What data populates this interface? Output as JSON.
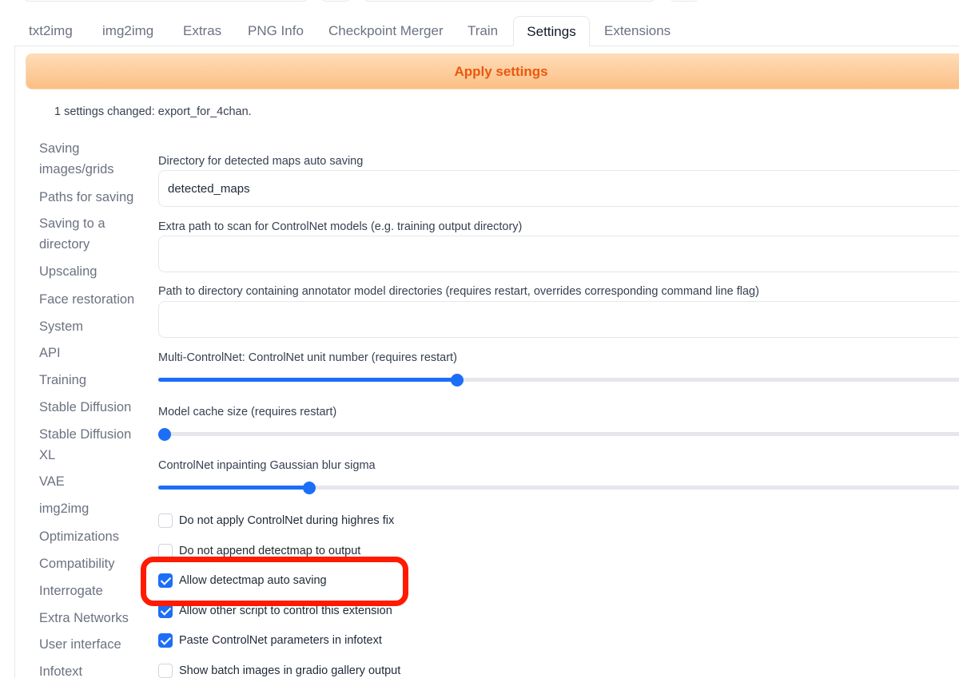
{
  "tabs": [
    {
      "label": "txt2img"
    },
    {
      "label": "img2img"
    },
    {
      "label": "Extras"
    },
    {
      "label": "PNG Info"
    },
    {
      "label": "Checkpoint Merger"
    },
    {
      "label": "Train"
    },
    {
      "label": "Settings",
      "active": true
    },
    {
      "label": "Extensions"
    }
  ],
  "apply_button": {
    "label": "Apply settings"
  },
  "changed_note": "1 settings changed: export_for_4chan.",
  "sidebar": {
    "items": [
      {
        "label": "Saving images/grids"
      },
      {
        "label": "Paths for saving"
      },
      {
        "label": "Saving to a directory"
      },
      {
        "label": "Upscaling"
      },
      {
        "label": "Face restoration"
      },
      {
        "label": "System"
      },
      {
        "label": "API"
      },
      {
        "label": "Training"
      },
      {
        "label": "Stable Diffusion"
      },
      {
        "label": "Stable Diffusion XL"
      },
      {
        "label": "VAE"
      },
      {
        "label": "img2img"
      },
      {
        "label": "Optimizations"
      },
      {
        "label": "Compatibility"
      },
      {
        "label": "Interrogate"
      },
      {
        "label": "Extra Networks"
      },
      {
        "label": "User interface"
      },
      {
        "label": "Infotext"
      }
    ]
  },
  "fields": {
    "detected_maps_dir": {
      "label": "Directory for detected maps auto saving",
      "value": "detected_maps"
    },
    "extra_models_path": {
      "label": "Extra path to scan for ControlNet models (e.g. training output directory)",
      "value": ""
    },
    "annotator_dir": {
      "label": "Path to directory containing annotator model directories (requires restart, overrides corresponding command line flag)",
      "value": ""
    }
  },
  "sliders": {
    "unit_number": {
      "label": "Multi-ControlNet: ControlNet unit number (requires restart)",
      "fraction": 0.37
    },
    "cache_size": {
      "label": "Model cache size (requires restart)",
      "fraction": 0.0
    },
    "blur_sigma": {
      "label": "ControlNet inpainting Gaussian blur sigma",
      "fraction": 0.187
    }
  },
  "checkboxes": {
    "no_highres": {
      "label": "Do not apply ControlNet during highres fix",
      "checked": false
    },
    "no_append": {
      "label": "Do not append detectmap to output",
      "checked": false
    },
    "auto_save": {
      "label": "Allow detectmap auto saving",
      "checked": true
    },
    "other_script": {
      "label": "Allow other script to control this extension",
      "checked": true
    },
    "paste_params": {
      "label": "Paste ControlNet parameters in infotext",
      "checked": true
    },
    "batch_gallery": {
      "label": "Show batch images in gradio gallery output",
      "checked": false
    }
  },
  "colors": {
    "accent": "#1d6ef7",
    "apply_text": "#ea580c",
    "highlight": "#ff1a00"
  }
}
